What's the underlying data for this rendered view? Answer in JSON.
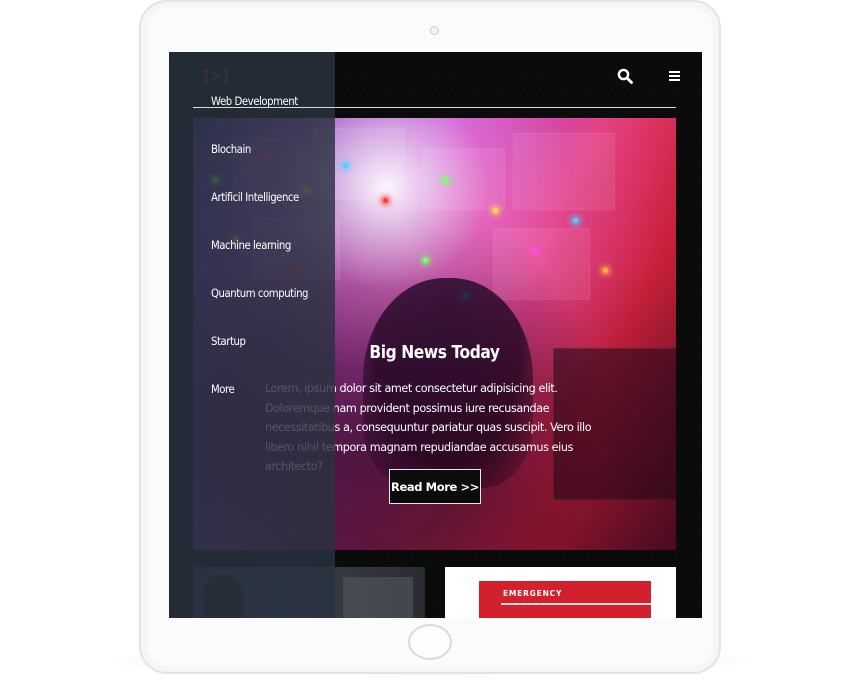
{
  "header": {
    "logo_text": "[>]",
    "icons": [
      "search-icon",
      "hamburger-menu-icon"
    ]
  },
  "side_nav": {
    "items": [
      {
        "label": "Web Development"
      },
      {
        "label": "Blochain"
      },
      {
        "label": "Artificil Intelligence"
      },
      {
        "label": "Machine learning"
      },
      {
        "label": "Quantum computing"
      },
      {
        "label": "Startup"
      },
      {
        "label": "More"
      }
    ]
  },
  "hero": {
    "title": "Big News Today",
    "body": "Lorem, ipsum dolor sit amet consectetur adipisicing elit. Doloremque nam provident possimus iure recusandae necessitatibus a, consequuntur pariatur quas suscipit. Vero illo libero nihil tempora magnam repudiandae accusamus eius architecto?",
    "button_label": "Read More >>"
  },
  "cards": [
    {
      "label": ""
    },
    {
      "label": "EMERGENCY"
    }
  ],
  "colors": {
    "screen_bg": "#0b0b0c",
    "nav_overlay": "#28323f",
    "hero_magenta": "#b24ad6",
    "hero_red": "#c8203b",
    "emergency_red": "#d3202d"
  }
}
